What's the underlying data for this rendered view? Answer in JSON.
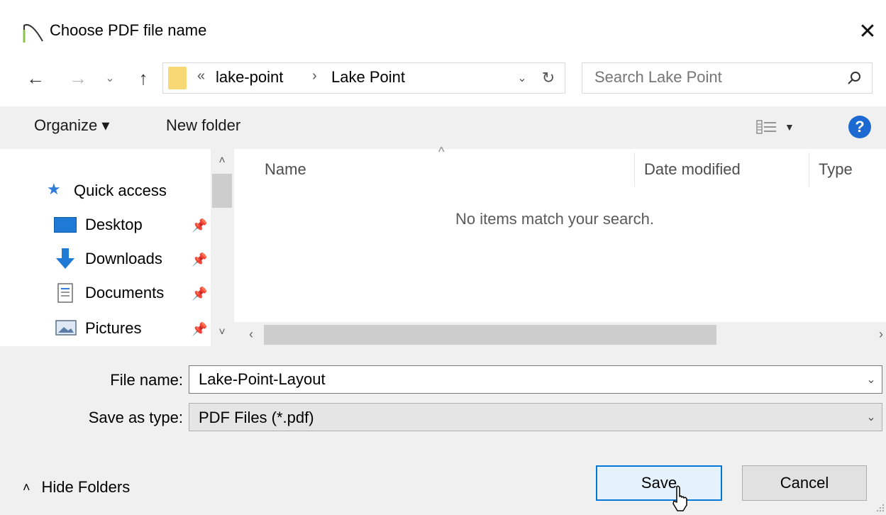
{
  "window": {
    "title": "Choose PDF file name",
    "close_glyph": "✕"
  },
  "address": {
    "overflow": "«",
    "crumbs": [
      "lake-point",
      "Lake Point"
    ],
    "separator": "›",
    "search_placeholder": "Search Lake Point"
  },
  "toolbar": {
    "organize_label": "Organize ▾",
    "new_folder_label": "New folder"
  },
  "nav_pane": {
    "items": [
      {
        "label": "Quick access",
        "icon": "star-icon"
      },
      {
        "label": "Desktop",
        "icon": "desktop-icon",
        "pinned": true
      },
      {
        "label": "Downloads",
        "icon": "download-icon",
        "pinned": true
      },
      {
        "label": "Documents",
        "icon": "documents-icon",
        "pinned": true
      },
      {
        "label": "Pictures",
        "icon": "pictures-icon",
        "pinned": true
      }
    ]
  },
  "file_list": {
    "columns": [
      "Name",
      "Date modified",
      "Type"
    ],
    "empty_message": "No items match your search."
  },
  "form": {
    "file_name_label": "File name:",
    "file_name_value": "Lake-Point-Layout",
    "save_type_label": "Save as type:",
    "save_type_value": "PDF Files (*.pdf)"
  },
  "footer": {
    "hide_folders_label": "Hide Folders",
    "save_label": "Save",
    "cancel_label": "Cancel"
  },
  "colors": {
    "accent": "#0078d7",
    "help": "#1c6ad1",
    "folder": "#f8d775",
    "panel": "#f0f0f0"
  }
}
